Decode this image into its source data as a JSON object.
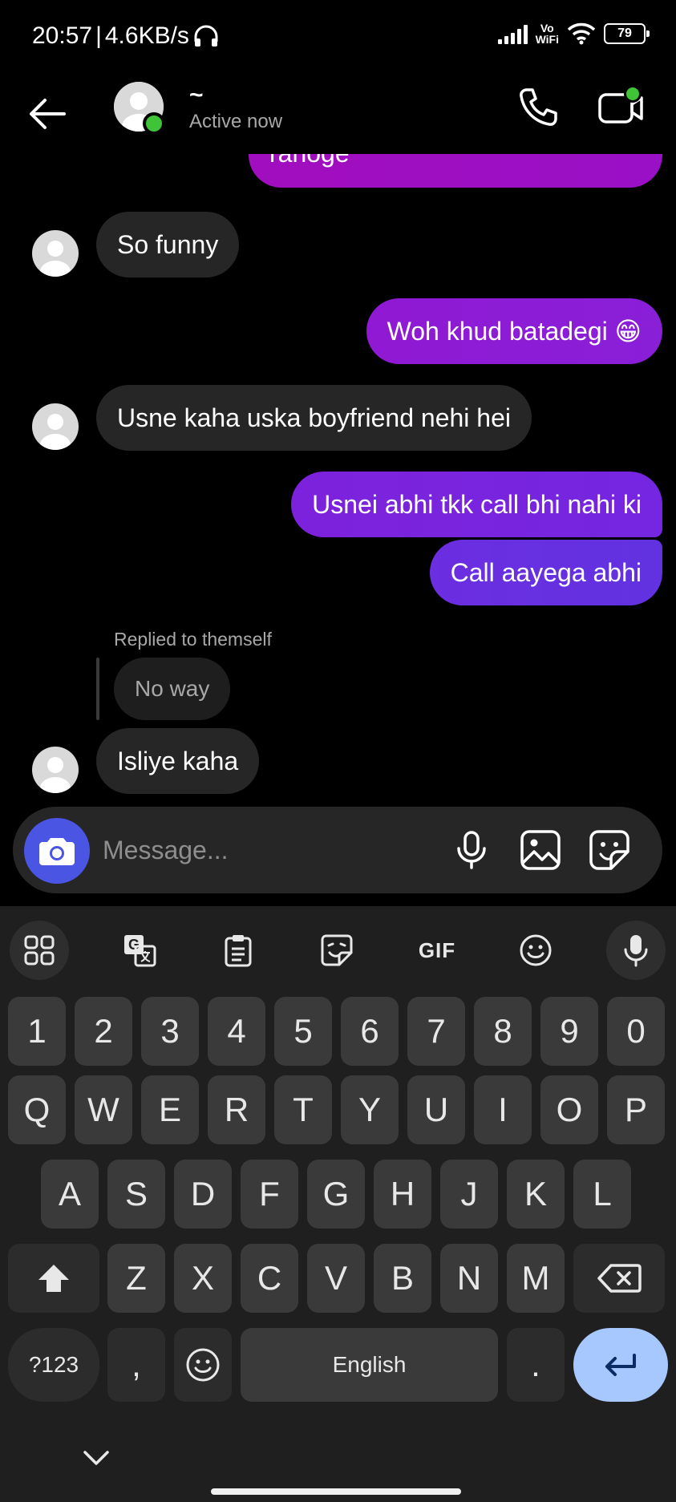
{
  "status_bar": {
    "time": "20:57",
    "separator": "|",
    "net_speed": "4.6KB/s",
    "vowifi_top": "Vo",
    "vowifi_bottom": "WiFi",
    "battery": "79"
  },
  "header": {
    "contact_name": "~",
    "active_status": "Active now"
  },
  "messages": [
    {
      "id": "m0",
      "direction": "outgoing",
      "text": "ranoge",
      "color": "#a00fbf"
    },
    {
      "id": "m1",
      "direction": "incoming",
      "text": "So funny"
    },
    {
      "id": "m2",
      "direction": "outgoing",
      "text": "Woh khud batadegi 😁",
      "color": "#8a1bd8"
    },
    {
      "id": "m3",
      "direction": "incoming",
      "text": "Usne kaha uska boyfriend nehi hei"
    },
    {
      "id": "m4",
      "direction": "outgoing",
      "text": "Usnei abhi tkk call bhi nahi ki",
      "color": "#7a22e0"
    },
    {
      "id": "m5",
      "direction": "outgoing",
      "text": "Call aayega abhi",
      "color": "#6a2fe0"
    },
    {
      "id": "m6",
      "direction": "incoming",
      "reply_label": "Replied to themself",
      "reply_quote": "No way",
      "text": "Isliye kaha"
    }
  ],
  "composer": {
    "placeholder": "Message..."
  },
  "keyboard": {
    "toolbar": [
      "apps-grid",
      "translate",
      "clipboard",
      "sticker",
      "GIF",
      "emoji",
      "voice"
    ],
    "gif_label": "GIF",
    "rows": {
      "numbers": [
        "1",
        "2",
        "3",
        "4",
        "5",
        "6",
        "7",
        "8",
        "9",
        "0"
      ],
      "row1": [
        "Q",
        "W",
        "E",
        "R",
        "T",
        "Y",
        "U",
        "I",
        "O",
        "P"
      ],
      "row2": [
        "A",
        "S",
        "D",
        "F",
        "G",
        "H",
        "J",
        "K",
        "L"
      ],
      "row3": [
        "Z",
        "X",
        "C",
        "V",
        "B",
        "N",
        "M"
      ]
    },
    "symbols_key": "?123",
    "comma_key": ",",
    "space_label": "English",
    "period_key": "."
  },
  "colors": {
    "accent_camera": "#4b55e3",
    "online": "#3ec436",
    "enter_key": "#a6c8ff"
  }
}
